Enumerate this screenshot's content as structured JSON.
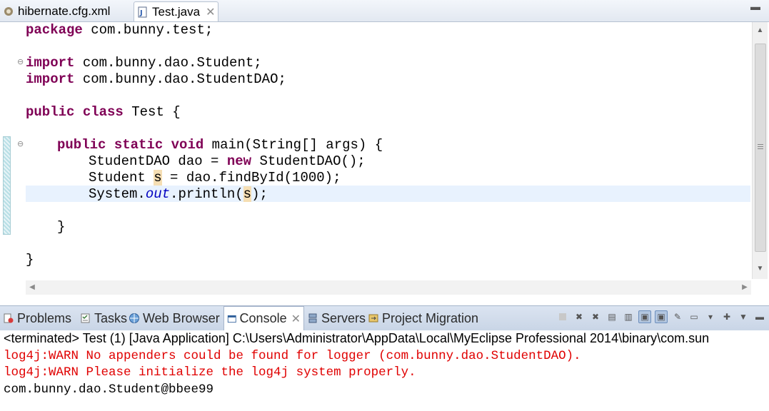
{
  "editor_tabs": [
    {
      "label": "hibernate.cfg.xml",
      "active": false
    },
    {
      "label": "Test.java",
      "active": true,
      "closable": true
    }
  ],
  "code": {
    "line_package": [
      "package",
      " com.bunny.test;"
    ],
    "line_import1": [
      "import",
      " com.bunny.dao.Student;"
    ],
    "line_import2": [
      "import",
      " com.bunny.dao.StudentDAO;"
    ],
    "line_class": [
      "public",
      " ",
      "class",
      " Test {"
    ],
    "line_main": [
      "public",
      " ",
      "static",
      " ",
      "void",
      " main(String[] args) {"
    ],
    "line_dao": [
      "StudentDAO dao = ",
      "new",
      " StudentDAO();"
    ],
    "line_find": [
      "Student ",
      "s",
      " = dao.findById(1000);"
    ],
    "line_print": [
      "System.",
      "out",
      ".println",
      "(",
      "s",
      ");"
    ],
    "line_close_main": "}",
    "line_close_class": "}"
  },
  "view_tabs": [
    {
      "label": "Problems",
      "icon": "problems-icon"
    },
    {
      "label": "Tasks",
      "icon": "tasks-icon"
    },
    {
      "label": "Web Browser",
      "icon": "web-browser-icon"
    },
    {
      "label": "Console",
      "icon": "console-icon",
      "active": true
    },
    {
      "label": "Servers",
      "icon": "servers-icon"
    },
    {
      "label": "Project Migration",
      "icon": "project-migration-icon"
    }
  ],
  "console": {
    "title": "<terminated> Test (1) [Java Application] C:\\Users\\Administrator\\AppData\\Local\\MyEclipse Professional 2014\\binary\\com.sun",
    "lines": [
      {
        "text": "log4j:WARN No appenders could be found for logger (com.bunny.dao.StudentDAO).",
        "type": "error"
      },
      {
        "text": "log4j:WARN Please initialize the log4j system properly.",
        "type": "error"
      },
      {
        "text": "com.bunny.dao.Student@bbee99",
        "type": "output"
      }
    ]
  },
  "colors": {
    "keyword": "#7f0055",
    "static_field": "#0000c0",
    "console_error": "#e00000",
    "current_line": "#e8f2fe",
    "occurrence_highlight": "#f5deb3"
  }
}
